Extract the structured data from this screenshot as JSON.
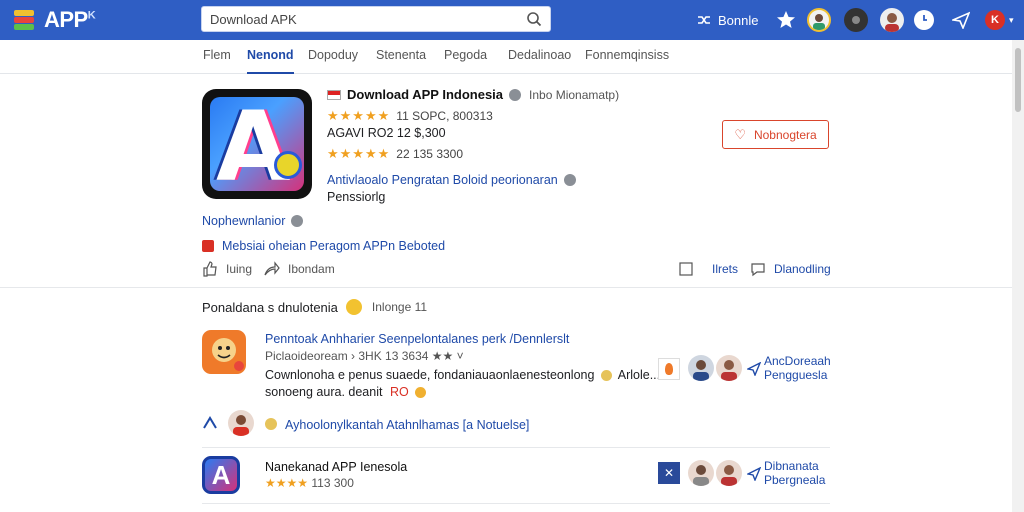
{
  "header": {
    "logo_text": "APP",
    "logo_superscript": "K",
    "search": {
      "value": "Download APK"
    },
    "user_label": "Bonnle"
  },
  "tabs": [
    {
      "label": "Flem"
    },
    {
      "label": "Nenond"
    },
    {
      "label": "Dopoduy"
    },
    {
      "label": "Stenenta"
    },
    {
      "label": "Pegoda"
    },
    {
      "label": "Dedalinoao"
    },
    {
      "label": "Fonnemqinsiss"
    }
  ],
  "app": {
    "title": "Download APP Indonesia",
    "subtitle": "Inbo Mionamatp)",
    "rating1": {
      "stars": "★★★★★",
      "text": "11 SOPC, 800313"
    },
    "price_line": "AGAVI RO2 12 $,300",
    "rating2": {
      "stars": "★★★★★",
      "text": "22 135 3300"
    },
    "category_link": "Antivlaoalo Pengratan Boloid peorionaran",
    "category_sub": "Penssiorlg",
    "follow_label": "Nobnogtera",
    "developer": "Nophewnlanior",
    "warning": "Mebsiai oheian Peragom APPn Beboted",
    "actions": {
      "like": "Iuing",
      "share": "Ibondam",
      "wish": "Ilrets",
      "comment": "Dlanodling"
    }
  },
  "section": {
    "title": "Ponaldana s dnulotenia",
    "extra": "Inlonge 11"
  },
  "items": [
    {
      "title": "Penntoak Anhharier Seenpelontalanes perk /Dennlerslt",
      "meta": "Piclaoideoream › 3HK 13 3634 ★★ ˅",
      "desc1": "Cownlonoha e penus suaede, fondaniauaonlaenesteonlong",
      "desc1_end": "Arlole...",
      "desc2": "sonoeng aura. deanit",
      "desc2_tag": "RO",
      "side1": "AncDoreaah",
      "side2": "Pengguesla"
    },
    {
      "reply": "Ayhoolonylkantah Atahnlhamas [a Notuelse]"
    },
    {
      "title": "Nanekanad APP Ienesola",
      "meta_stars": "★★★★",
      "meta": "113 300",
      "side1": "Dibnanata",
      "side2": "Pbergneala"
    }
  ],
  "colors": {
    "header": "#2f5ec4",
    "accent": "#1f4aa8",
    "star": "#f0a020",
    "danger": "#d9452c"
  }
}
